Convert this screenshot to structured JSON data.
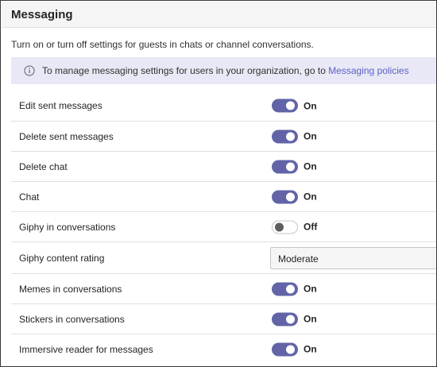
{
  "section": {
    "title": "Messaging",
    "description": "Turn on or turn off settings for guests in chats or channel conversations."
  },
  "banner": {
    "icon": "info-icon",
    "text": "To manage messaging settings for users in your organization, go to ",
    "link_label": "Messaging policies"
  },
  "settings": [
    {
      "label": "Edit sent messages",
      "type": "toggle",
      "on": true,
      "state": "On"
    },
    {
      "label": "Delete sent messages",
      "type": "toggle",
      "on": true,
      "state": "On"
    },
    {
      "label": "Delete chat",
      "type": "toggle",
      "on": true,
      "state": "On"
    },
    {
      "label": "Chat",
      "type": "toggle",
      "on": true,
      "state": "On"
    },
    {
      "label": "Giphy in conversations",
      "type": "toggle",
      "on": false,
      "state": "Off"
    },
    {
      "label": "Giphy content rating",
      "type": "select",
      "value": "Moderate"
    },
    {
      "label": "Memes in conversations",
      "type": "toggle",
      "on": true,
      "state": "On"
    },
    {
      "label": "Stickers in conversations",
      "type": "toggle",
      "on": true,
      "state": "On"
    },
    {
      "label": "Immersive reader for messages",
      "type": "toggle",
      "on": true,
      "state": "On"
    }
  ],
  "colors": {
    "accent": "#6264a7",
    "banner_bg": "#e8e8f6",
    "link": "#5b5fc7"
  }
}
